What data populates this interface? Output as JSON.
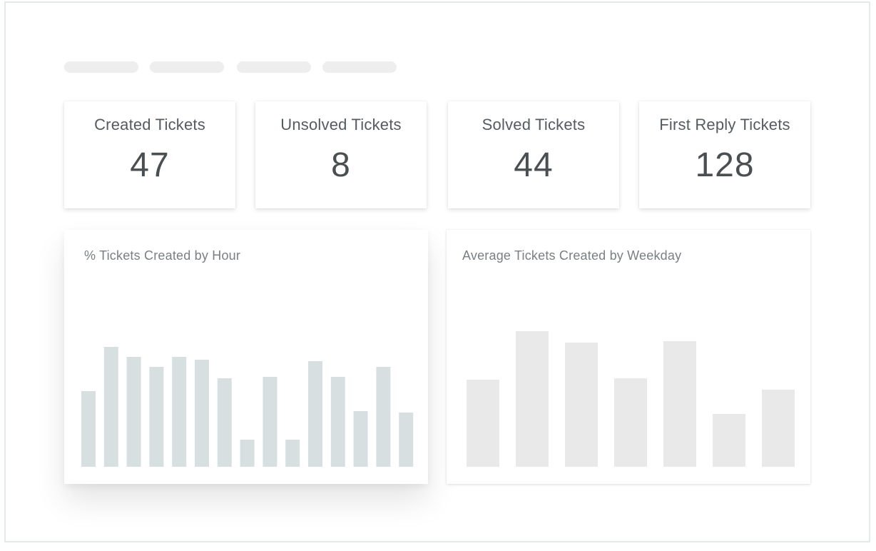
{
  "tabs": [
    "",
    "",
    "",
    ""
  ],
  "stats": [
    {
      "label": "Created Tickets",
      "value": "47"
    },
    {
      "label": "Unsolved Tickets",
      "value": "8"
    },
    {
      "label": "Solved Tickets",
      "value": "44"
    },
    {
      "label": "First Reply Tickets",
      "value": "128"
    }
  ],
  "colors": {
    "hour_bar": "#d8dfe0",
    "weekday_bar": "#e9e9e9",
    "tab_pill": "#eeeeee"
  },
  "chart_data": [
    {
      "type": "bar",
      "title": "% Tickets Created by Hour",
      "xlabel": "",
      "ylabel": "",
      "grid": false,
      "values": [
        53,
        84,
        77,
        70,
        77,
        75,
        62,
        19,
        63,
        19,
        74,
        63,
        39,
        70,
        38
      ],
      "ylim": [
        0,
        100
      ]
    },
    {
      "type": "bar",
      "title": "Average Tickets Created by Weekday",
      "xlabel": "",
      "ylabel": "",
      "grid": false,
      "values": [
        61,
        95,
        87,
        62,
        88,
        37,
        54
      ],
      "ylim": [
        0,
        100
      ]
    }
  ]
}
